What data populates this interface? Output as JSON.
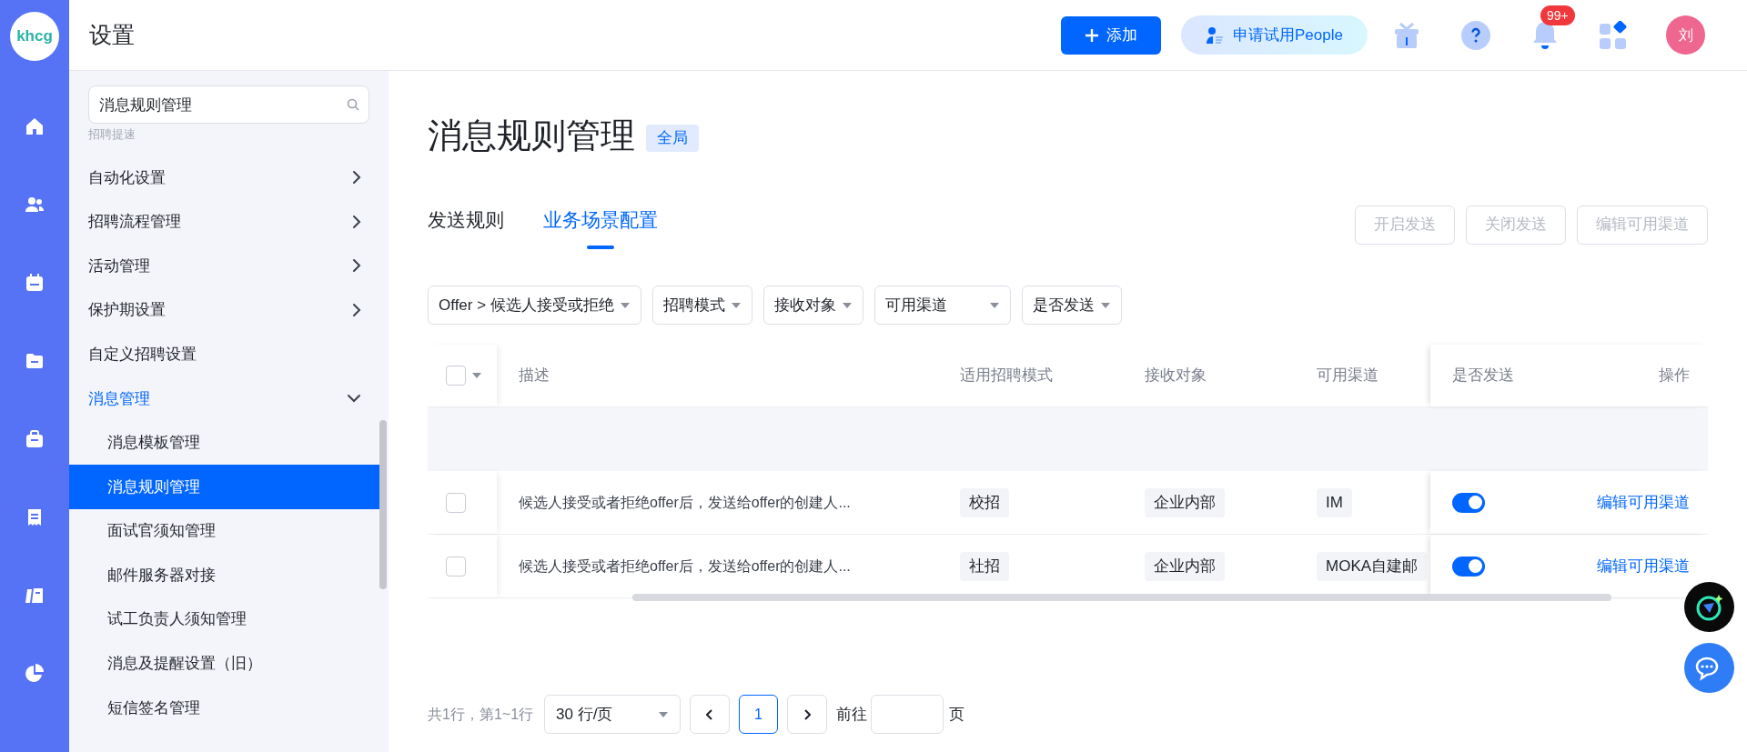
{
  "rail": {
    "logo": "khcg"
  },
  "header": {
    "title": "设置",
    "add_button": "添加",
    "trial_button": "申请试用People",
    "notification_badge": "99+",
    "avatar": "刘"
  },
  "sidebar": {
    "search": {
      "value": "消息规则管理"
    },
    "hint": "招聘提速",
    "items": [
      {
        "label": "自动化设置",
        "kind": "group",
        "expanded": false,
        "selected": false
      },
      {
        "label": "招聘流程管理",
        "kind": "group",
        "expanded": false,
        "selected": false
      },
      {
        "label": "活动管理",
        "kind": "group",
        "expanded": false,
        "selected": false
      },
      {
        "label": "保护期设置",
        "kind": "group",
        "expanded": false,
        "selected": false
      },
      {
        "label": "自定义招聘设置",
        "kind": "link",
        "selected": false
      },
      {
        "label": "消息管理",
        "kind": "group",
        "expanded": true,
        "selected": true,
        "children": [
          {
            "label": "消息模板管理",
            "selected": false
          },
          {
            "label": "消息规则管理",
            "selected": true
          },
          {
            "label": "面试官须知管理",
            "selected": false
          },
          {
            "label": "邮件服务器对接",
            "selected": false
          },
          {
            "label": "试工负责人须知管理",
            "selected": false
          },
          {
            "label": "消息及提醒设置（旧）",
            "selected": false
          },
          {
            "label": "短信签名管理",
            "selected": false
          }
        ]
      }
    ]
  },
  "page": {
    "title": "消息规则管理",
    "scope_badge": "全局",
    "tabs": [
      {
        "label": "发送规则",
        "selected": false
      },
      {
        "label": "业务场景配置",
        "selected": true
      }
    ],
    "actions": [
      {
        "label": "开启发送",
        "disabled": true
      },
      {
        "label": "关闭发送",
        "disabled": true
      },
      {
        "label": "编辑可用渠道",
        "disabled": true
      }
    ],
    "filters": [
      {
        "label": "Offer > 候选人接受或拒绝"
      },
      {
        "label": "招聘模式"
      },
      {
        "label": "接收对象"
      },
      {
        "label": "可用渠道"
      },
      {
        "label": "是否发送"
      }
    ],
    "table": {
      "all_checked": false,
      "columns": [
        "描述",
        "适用招聘模式",
        "接收对象",
        "可用渠道",
        "是否发送",
        "操作"
      ],
      "rows": [
        {
          "checked": false,
          "description": "候选人接受或者拒绝offer后，发送给offer的创建人...",
          "mode": "校招",
          "receiver": "企业内部",
          "channel": "IM",
          "send": true,
          "action": "编辑可用渠道"
        },
        {
          "checked": false,
          "description": "候选人接受或者拒绝offer后，发送给offer的创建人...",
          "mode": "社招",
          "receiver": "企业内部",
          "channel": "MOKA自建邮",
          "send": true,
          "action": "编辑可用渠道"
        }
      ]
    },
    "pagination": {
      "summary": "共1行，第1~1行",
      "page_size": "30 行/页",
      "pages": [
        {
          "label": "1",
          "selected": true
        }
      ],
      "goto_label": "前往",
      "page_unit": "页"
    }
  }
}
